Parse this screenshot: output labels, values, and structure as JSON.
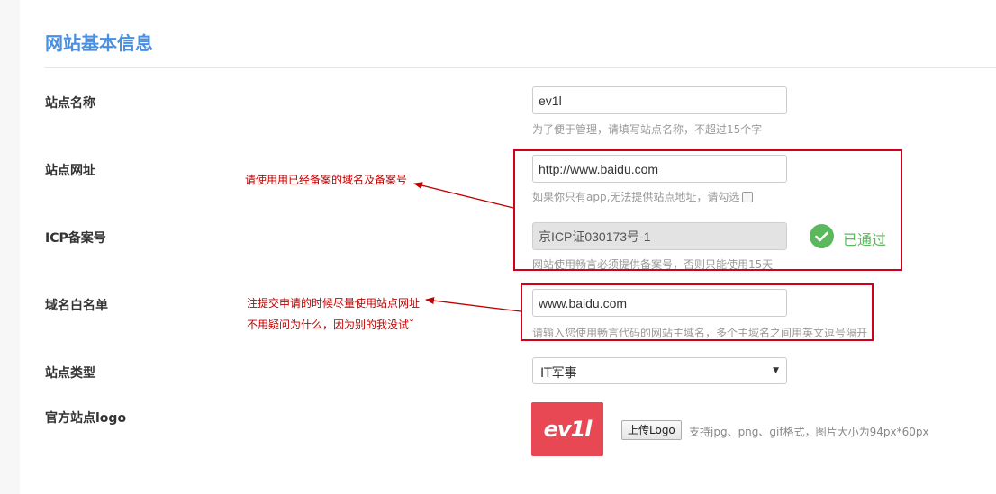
{
  "section_title": "网站基本信息",
  "fields": {
    "site_name": {
      "label": "站点名称",
      "value": "ev1l",
      "help": "为了便于管理，请填写站点名称，不超过15个字"
    },
    "site_url": {
      "label": "站点网址",
      "value": "http://www.baidu.com",
      "help": "如果你只有app,无法提供站点地址，请勾选"
    },
    "icp": {
      "label": "ICP备案号",
      "value": "京ICP证030173号-1",
      "help": "网站使用畅言必须提供备案号，否则只能使用15天",
      "status": "已通过"
    },
    "domain_whitelist": {
      "label": "域名白名单",
      "value": "www.baidu.com",
      "help": "请输入您使用畅言代码的网站主域名，多个主域名之间用英文逗号隔开"
    },
    "site_type": {
      "label": "站点类型",
      "selected": "IT军事"
    },
    "logo": {
      "label": "官方站点logo",
      "logo_text": "ev1l",
      "upload_label": "上传Logo",
      "hint": "支持jpg、png、gif格式，图片大小为94px*60px"
    }
  },
  "annotations": {
    "note1": "请使用用已经备案的域名及备案号",
    "note2_line1": "注提交申请的时候尽量使用站点网址",
    "note2_line2": "不用疑问为什么，因为别的我没试˘"
  },
  "colors": {
    "title": "#4a90e2",
    "passed": "#5cb85c",
    "logo_bg": "#e84854",
    "annotation": "#d0021b"
  },
  "icons": {
    "status": "check-circle-icon",
    "select": "chevron-down-icon"
  }
}
